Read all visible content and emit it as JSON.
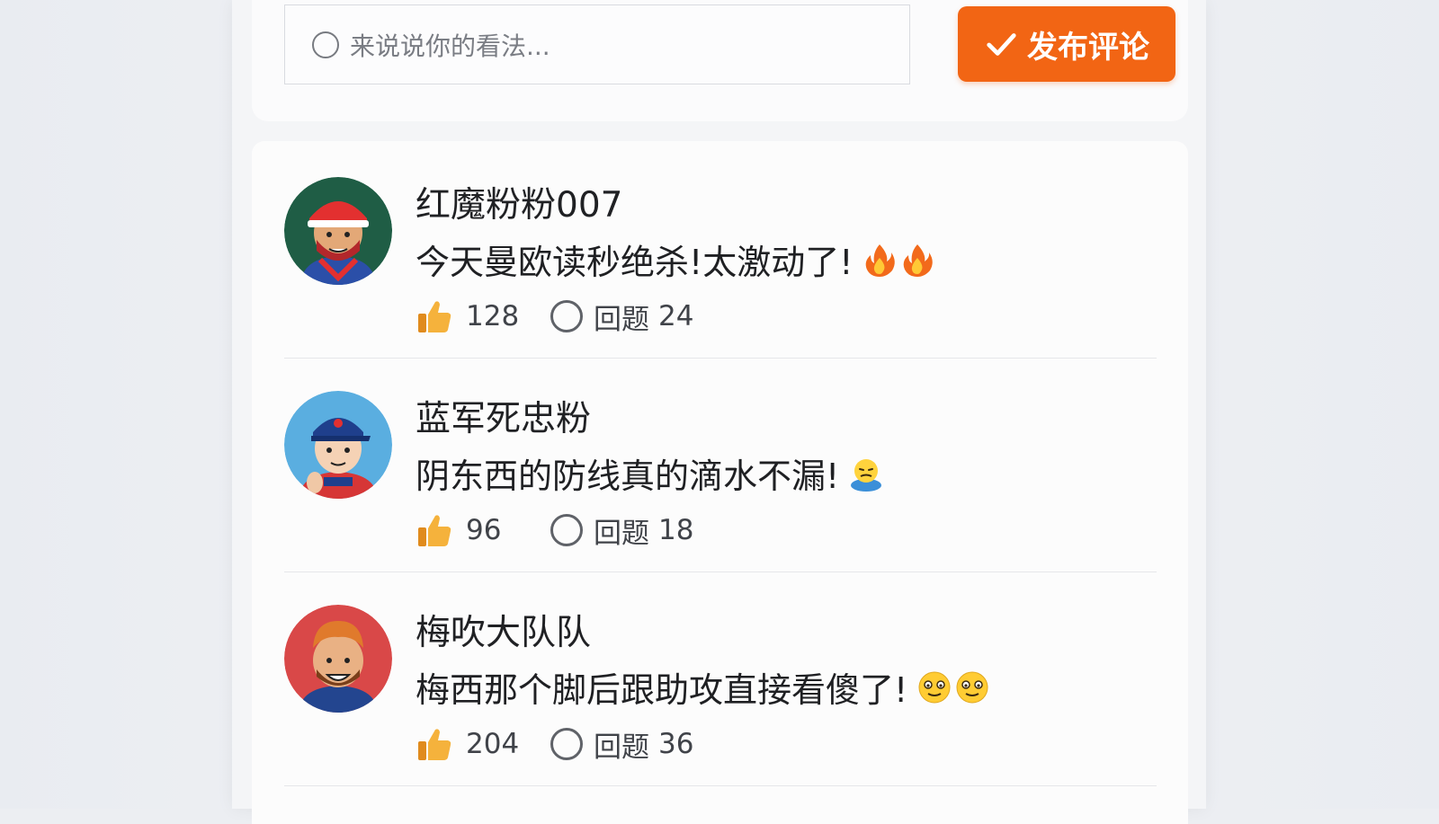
{
  "composer": {
    "placeholder": "来说说你的看法...",
    "submit_label": "发布评论"
  },
  "comments": [
    {
      "username": "红魔粉粉007",
      "text": "今天曼欧读秒绝杀!太激动了!",
      "emoji": [
        "fire-emoji",
        "fire-emoji"
      ],
      "likes": "128",
      "reply_label": "回题",
      "replies": "24",
      "avatar_color": "#1f5d45"
    },
    {
      "username": "蓝军死忠粉",
      "text": "阴东西的防线真的滴水不漏!",
      "emoji": [
        "nervous-face-emoji"
      ],
      "likes": "96",
      "reply_label": "回题",
      "replies": "18",
      "avatar_color": "#5aaee0"
    },
    {
      "username": "梅吹大队队",
      "text": "梅西那个脚后跟助攻直接看傻了!",
      "emoji": [
        "dazed-face-emoji",
        "dazed-face-emoji"
      ],
      "likes": "204",
      "reply_label": "回题",
      "replies": "36",
      "avatar_color": "#d94848"
    }
  ],
  "colors": {
    "accent": "#f26514",
    "like_icon": "#f2a43a"
  }
}
